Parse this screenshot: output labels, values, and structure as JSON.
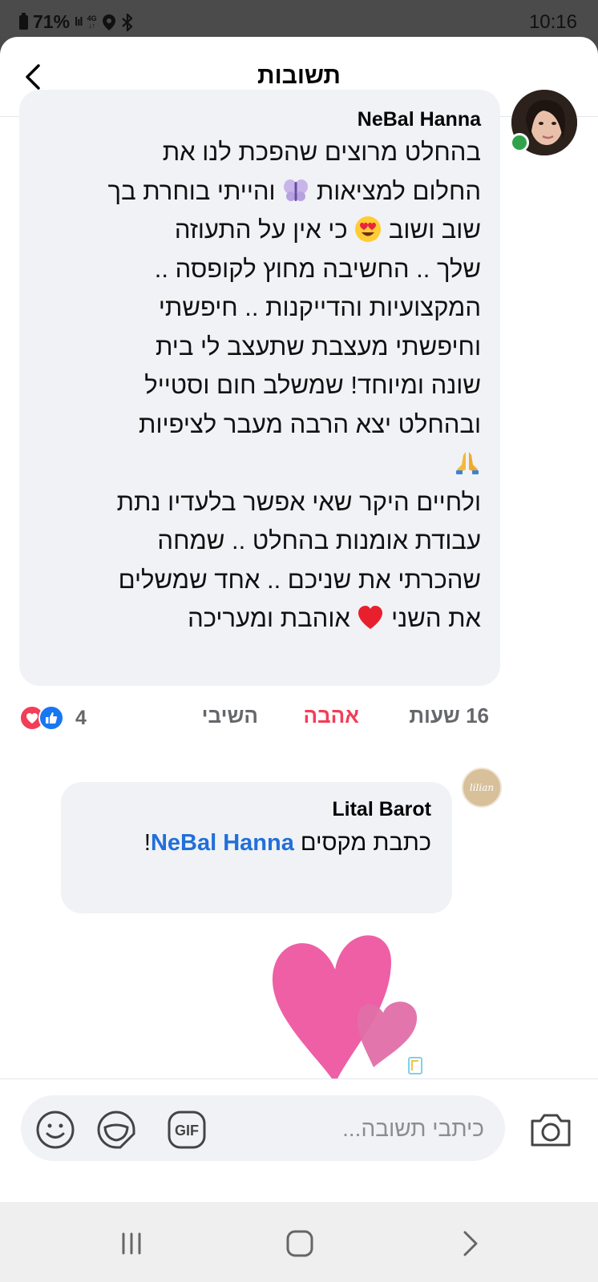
{
  "status_bar": {
    "battery": "71%",
    "network": "4G",
    "time": "10:16"
  },
  "header": {
    "title": "תשובות",
    "back_icon": "chevron-left-icon"
  },
  "comment": {
    "author": "NeBal Hanna",
    "online": true,
    "lines": [
      "בהחלט מרוצים שהפכת לנו את",
      "החלום למציאות",
      "והייתי בוחרת בך",
      "שוב ושוב",
      "כי אין על התעוזה",
      "שלך .. החשיבה מחוץ לקופסה ..",
      "המקצועיות והדייקנות ..  חיפשתי",
      "וחיפשתי מעצבת שתעצב לי בית",
      "שונה ומיוחד! שמשלב חום וסטייל",
      "ובהחלט יצא הרבה מעבר לציפיות",
      "ולחיים היקר שאי אפשר בלעדיו נתת",
      "עבודת אומנות בהחלט .. שמחה",
      "שהכרתי את שניכם  .. אחד שמשלים",
      "את השני",
      "אוהבת ומעריכה"
    ],
    "emoji_icons": [
      "fairy-icon",
      "heart-eyes-emoji",
      "praying-hands-emoji",
      "red-heart-emoji"
    ],
    "time": "16 שעות",
    "love_label": "אהבה",
    "reply_label": "השיבי",
    "reaction_count": "4",
    "reaction_icons": [
      "love-reaction-icon",
      "like-reaction-icon"
    ],
    "love_color": "#f33e58"
  },
  "reply": {
    "author": "Lital Barot",
    "avatar_text": "lilian",
    "text_before": "כתבת מקסים ",
    "mention": "NeBal Hanna",
    "text_after": "!",
    "sticker": "pink-hearts-sticker",
    "mention_color": "#216fdb"
  },
  "composer": {
    "placeholder": "כיתבי תשובה...",
    "icons": [
      "camera-icon",
      "gif-icon",
      "sticker-icon",
      "emoji-icon"
    ],
    "gif_label": "GIF"
  },
  "nav": {
    "icons": [
      "recent-apps-icon",
      "home-icon",
      "back-icon"
    ]
  }
}
